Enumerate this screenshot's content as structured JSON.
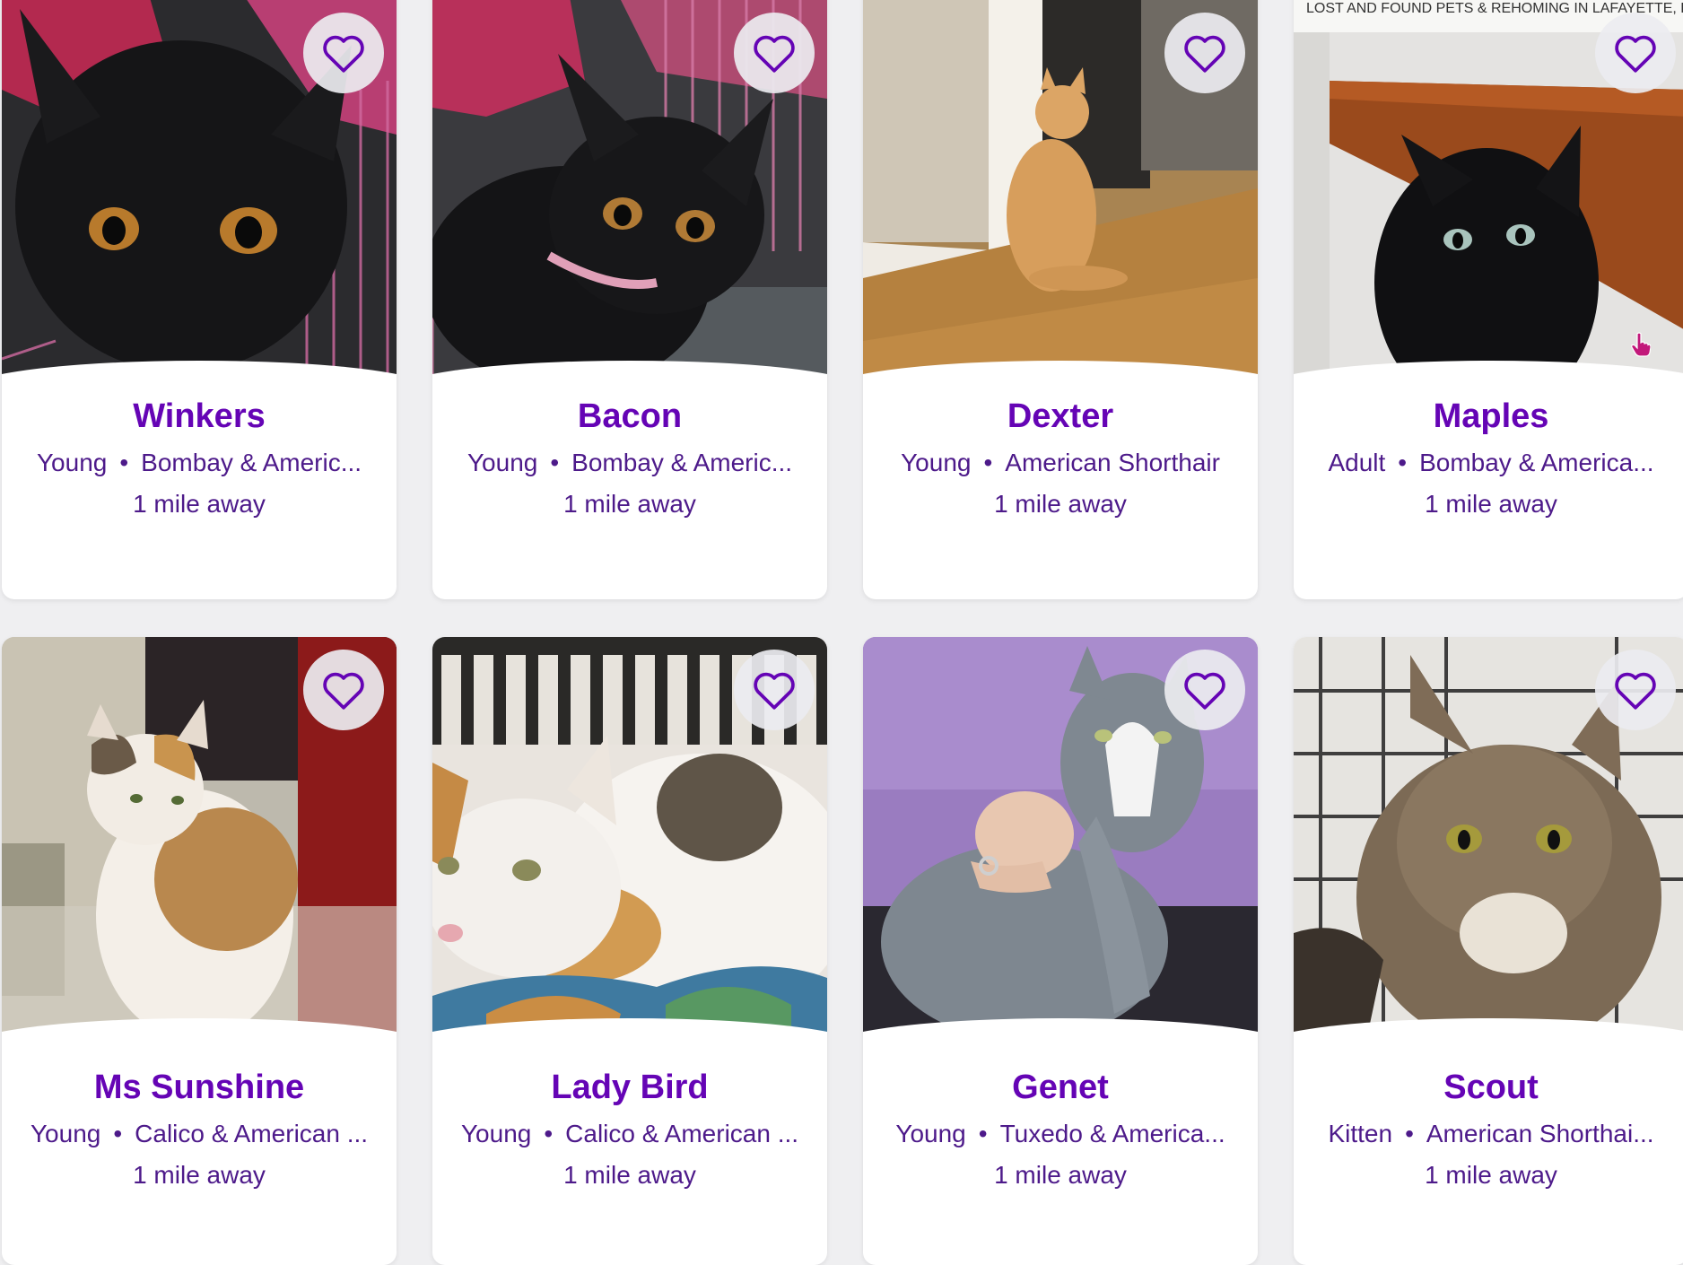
{
  "accent_color": "#6504b5",
  "text_color": "#4d1a8a",
  "photo_banner_text": "LOST AND FOUND PETS & REHOMING IN LAFAYETTE, LOU",
  "favorite_icon": "heart-outline-icon",
  "pets": [
    {
      "name": "Winkers",
      "age": "Young",
      "breed": "Bombay & Americ...",
      "distance": "1 mile away"
    },
    {
      "name": "Bacon",
      "age": "Young",
      "breed": "Bombay & Americ...",
      "distance": "1 mile away"
    },
    {
      "name": "Dexter",
      "age": "Young",
      "breed": "American Shorthair",
      "distance": "1 mile away"
    },
    {
      "name": "Maples",
      "age": "Adult",
      "breed": "Bombay & America...",
      "distance": "1 mile away"
    },
    {
      "name": "Ms Sunshine",
      "age": "Young",
      "breed": "Calico & American ...",
      "distance": "1 mile away"
    },
    {
      "name": "Lady Bird",
      "age": "Young",
      "breed": "Calico & American ...",
      "distance": "1 mile away"
    },
    {
      "name": "Genet",
      "age": "Young",
      "breed": "Tuxedo & America...",
      "distance": "1 mile away"
    },
    {
      "name": "Scout",
      "age": "Kitten",
      "breed": "American Shorthai...",
      "distance": "1 mile away"
    }
  ]
}
